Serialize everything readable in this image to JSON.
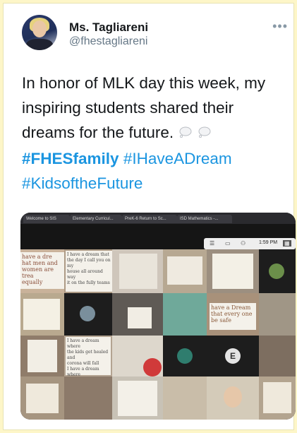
{
  "tweet": {
    "author_name": "Ms. Tagliareni",
    "author_handle": "@fhestagliareni",
    "more_icon": "more-horizontal-icon",
    "text": "In honor of MLK day this week, my inspiring students shared their dreams for the future.",
    "emoji": [
      "thought-balloon-icon",
      "thought-balloon-icon"
    ],
    "hashtags": [
      "#FHESfamily",
      "#IHaveADream",
      "#KidsoftheFuture"
    ]
  },
  "media": {
    "browser_tabs": [
      "Welcome to SIS",
      "Elementary Curricul...",
      "PreK-6 Return to Sc...",
      "ISD Mathematics -..."
    ],
    "zoom_time": "1:59 PM",
    "notes": {
      "top_left": "have a dre\nhat men and\nwomen are trea\nequally",
      "top_center": "I have a dream that\nthe day I call you on my\nhouse all around way\nit on the fully teams",
      "mid_right": "have a Dream\nthat every one\nbe safe",
      "bottom_left": "I have a dream where\nthe kids get healed and\ncorona will fall\nI have a dream where\nnurses will be found"
    }
  }
}
